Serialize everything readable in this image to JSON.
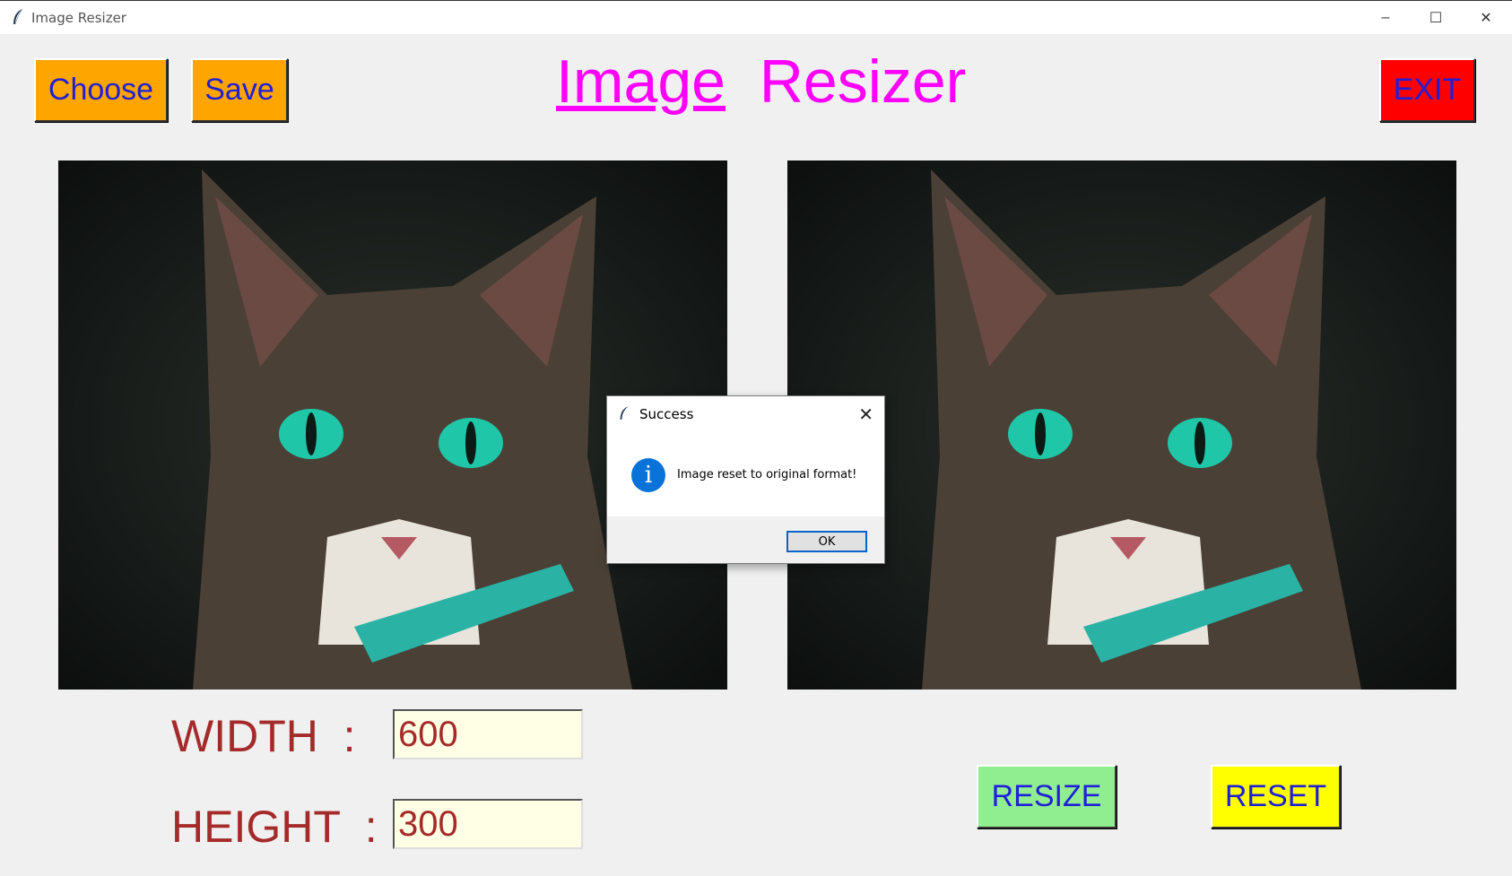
{
  "window": {
    "title": "Image Resizer"
  },
  "toolbar": {
    "choose_label": "Choose",
    "save_label": "Save",
    "exit_label": "EXIT"
  },
  "app_title": {
    "first": "Image",
    "second": "Resizer"
  },
  "form": {
    "width_label": "WIDTH  :",
    "width_value": "600",
    "height_label": "HEIGHT  :",
    "height_value": "300"
  },
  "actions": {
    "resize_label": "RESIZE",
    "reset_label": "RESET"
  },
  "dialog": {
    "title": "Success",
    "message": "Image reset to original format!",
    "ok_label": "OK"
  },
  "colors": {
    "title": "#ff00ff",
    "button_orange": "#ffa500",
    "button_red": "#ff0000",
    "button_green": "#90ee90",
    "button_yellow": "#ffff00",
    "label_brown": "#a52a2a",
    "entry_bg": "#ffffe6"
  },
  "icons": [
    "feather-icon",
    "minimize-icon",
    "maximize-icon",
    "close-icon",
    "info-icon"
  ]
}
